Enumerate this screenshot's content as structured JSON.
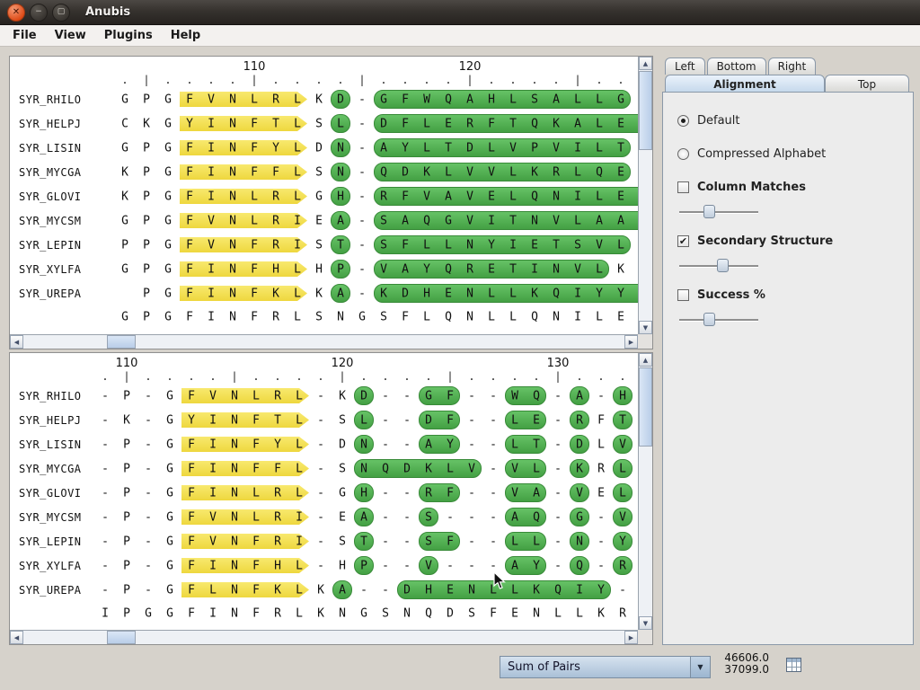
{
  "window": {
    "title": "Anubis"
  },
  "menu": {
    "items": [
      "File",
      "View",
      "Plugins",
      "Help"
    ]
  },
  "colors": {
    "strand_yellow": "#f0dd45",
    "helix_green": "#4fae4f",
    "selected_tab_blue": "#c6d9ec",
    "scroll_thumb_blue": "#b9cee8",
    "titlebar_dark": "#36322e",
    "close_button_orange": "#dd4814"
  },
  "alignment_panels": [
    {
      "id": "top",
      "col_start": 116,
      "cols": 25,
      "ruler_labels": [
        {
          "col": 6,
          "text": "110"
        },
        {
          "col": 16,
          "text": "120"
        }
      ],
      "rows": [
        {
          "name": "SYR_RHILO",
          "letters": "GPGFVNLRLKD-GFWQAHLSALLGD",
          "segments": [
            [
              "strand",
              3,
              8
            ],
            [
              "helix",
              10,
              10
            ],
            [
              "helix",
              12,
              23
            ]
          ]
        },
        {
          "name": "SYR_HELPJ",
          "letters": "CKGYINFTLSL-DFLERFTQKALEL",
          "segments": [
            [
              "strand",
              3,
              8
            ],
            [
              "helix",
              10,
              10
            ],
            [
              "helix",
              12,
              24
            ]
          ]
        },
        {
          "name": "SYR_LISIN",
          "letters": "GPGFINFYLDN-AYLTDLVPVILTE",
          "segments": [
            [
              "strand",
              3,
              8
            ],
            [
              "helix",
              10,
              10
            ],
            [
              "helix",
              12,
              23
            ]
          ]
        },
        {
          "name": "SYR_MYCGA",
          "letters": "KPGFINFFLSN-QDKLVVLKRLQET",
          "segments": [
            [
              "strand",
              3,
              8
            ],
            [
              "helix",
              10,
              10
            ],
            [
              "helix",
              12,
              23
            ]
          ]
        },
        {
          "name": "SYR_GLOVI",
          "letters": "KPGFINLRLGH-RFVAVELQNILEL",
          "segments": [
            [
              "strand",
              3,
              8
            ],
            [
              "helix",
              10,
              10
            ],
            [
              "helix",
              12,
              24
            ]
          ]
        },
        {
          "name": "SYR_MYCSM",
          "letters": "GPGFVNLRIEA-SAQGVITNVLAAL",
          "segments": [
            [
              "strand",
              3,
              8
            ],
            [
              "helix",
              10,
              10
            ],
            [
              "helix",
              12,
              24
            ]
          ]
        },
        {
          "name": "SYR_LEPIN",
          "letters": "PPGFVNFRIST-SFLLNYIETSVLS",
          "segments": [
            [
              "strand",
              3,
              8
            ],
            [
              "helix",
              10,
              10
            ],
            [
              "helix",
              12,
              23
            ]
          ]
        },
        {
          "name": "SYR_XYLFA",
          "letters": "GPGFINFHLHP-VAYQRETINVLKQ",
          "segments": [
            [
              "strand",
              3,
              8
            ],
            [
              "helix",
              10,
              10
            ],
            [
              "helix",
              12,
              22
            ]
          ]
        },
        {
          "name": "SYR_UREPA",
          "letters": " PGFINFKLKA-KDHENLLKQIYYE",
          "segments": [
            [
              "strand",
              3,
              8
            ],
            [
              "helix",
              10,
              10
            ],
            [
              "helix",
              12,
              24
            ]
          ]
        }
      ],
      "consensus": "GPGFINFRLSNGSFLQNLLQNILEE"
    },
    {
      "id": "bottom",
      "col_start": 94,
      "cols": 25,
      "ruler_labels": [
        {
          "col": 1,
          "text": "110"
        },
        {
          "col": 11,
          "text": "120"
        },
        {
          "col": 21,
          "text": "130"
        }
      ],
      "rows": [
        {
          "name": "SYR_RHILO",
          "letters": "-P-GFVNLRL-KD--GF--WQ-A-H",
          "segments": [
            [
              "strand",
              4,
              9
            ],
            [
              "helix",
              12,
              12
            ],
            [
              "helix",
              15,
              16
            ],
            [
              "helix",
              19,
              20
            ],
            [
              "helix",
              22,
              22
            ],
            [
              "helix",
              24,
              24
            ]
          ]
        },
        {
          "name": "SYR_HELPJ",
          "letters": "-K-GYINFTL-SL--DF--LE-RFT",
          "segments": [
            [
              "strand",
              4,
              9
            ],
            [
              "helix",
              12,
              12
            ],
            [
              "helix",
              15,
              16
            ],
            [
              "helix",
              19,
              20
            ],
            [
              "helix",
              22,
              22
            ],
            [
              "helix",
              24,
              24
            ]
          ]
        },
        {
          "name": "SYR_LISIN",
          "letters": "-P-GFINFYL-DN--AY--LT-DLV",
          "segments": [
            [
              "strand",
              4,
              9
            ],
            [
              "helix",
              12,
              12
            ],
            [
              "helix",
              15,
              16
            ],
            [
              "helix",
              19,
              20
            ],
            [
              "helix",
              22,
              22
            ],
            [
              "helix",
              24,
              24
            ]
          ]
        },
        {
          "name": "SYR_MYCGA",
          "letters": "-P-GFINFFL-SNQDKLV-VL-KRL",
          "segments": [
            [
              "strand",
              4,
              9
            ],
            [
              "helix",
              12,
              17
            ],
            [
              "helix",
              19,
              20
            ],
            [
              "helix",
              22,
              22
            ],
            [
              "helix",
              24,
              24
            ]
          ]
        },
        {
          "name": "SYR_GLOVI",
          "letters": "-P-GFINLRL-GH--RF--VA-VEL",
          "segments": [
            [
              "strand",
              4,
              9
            ],
            [
              "helix",
              12,
              12
            ],
            [
              "helix",
              15,
              16
            ],
            [
              "helix",
              19,
              20
            ],
            [
              "helix",
              22,
              22
            ],
            [
              "helix",
              24,
              24
            ]
          ]
        },
        {
          "name": "SYR_MYCSM",
          "letters": "-P-GFVNLRI-EA--S---AQ-G-V",
          "segments": [
            [
              "strand",
              4,
              9
            ],
            [
              "helix",
              12,
              12
            ],
            [
              "helix",
              15,
              15
            ],
            [
              "helix",
              19,
              20
            ],
            [
              "helix",
              22,
              22
            ],
            [
              "helix",
              24,
              24
            ]
          ]
        },
        {
          "name": "SYR_LEPIN",
          "letters": "-P-GFVNFRI-ST--SF--LL-N-Y",
          "segments": [
            [
              "strand",
              4,
              9
            ],
            [
              "helix",
              12,
              12
            ],
            [
              "helix",
              15,
              16
            ],
            [
              "helix",
              19,
              20
            ],
            [
              "helix",
              22,
              22
            ],
            [
              "helix",
              24,
              24
            ]
          ]
        },
        {
          "name": "SYR_XYLFA",
          "letters": "-P-GFINFHL-HP--V---AY-Q-R",
          "segments": [
            [
              "strand",
              4,
              9
            ],
            [
              "helix",
              12,
              12
            ],
            [
              "helix",
              15,
              15
            ],
            [
              "helix",
              19,
              20
            ],
            [
              "helix",
              22,
              22
            ],
            [
              "helix",
              24,
              24
            ]
          ]
        },
        {
          "name": "SYR_UREPA",
          "letters": "-P-GFLNFKLKA--DHENLLKQIY-",
          "segments": [
            [
              "strand",
              4,
              9
            ],
            [
              "helix",
              11,
              11
            ],
            [
              "helix",
              14,
              23
            ]
          ]
        }
      ],
      "consensus": "IPGGFINFRLKNGSNQDSFENLLKR"
    }
  ],
  "side_panel": {
    "tabs_small": [
      "Left",
      "Bottom",
      "Right"
    ],
    "tabs_main": [
      {
        "label": "Alignment",
        "selected": true
      },
      {
        "label": "Top",
        "selected": false
      }
    ],
    "radios": [
      {
        "label": "Default",
        "selected": true
      },
      {
        "label": "Compressed Alphabet",
        "selected": false
      }
    ],
    "controls": [
      {
        "label": "Column Matches",
        "checked": false,
        "slider_percent": 38
      },
      {
        "label": "Secondary Structure",
        "checked": true,
        "slider_percent": 55
      },
      {
        "label": "Success %",
        "checked": false,
        "slider_percent": 38
      }
    ]
  },
  "status_bar": {
    "dropdown_label": "Sum of Pairs",
    "values": [
      "46606.0",
      "37099.0"
    ]
  }
}
